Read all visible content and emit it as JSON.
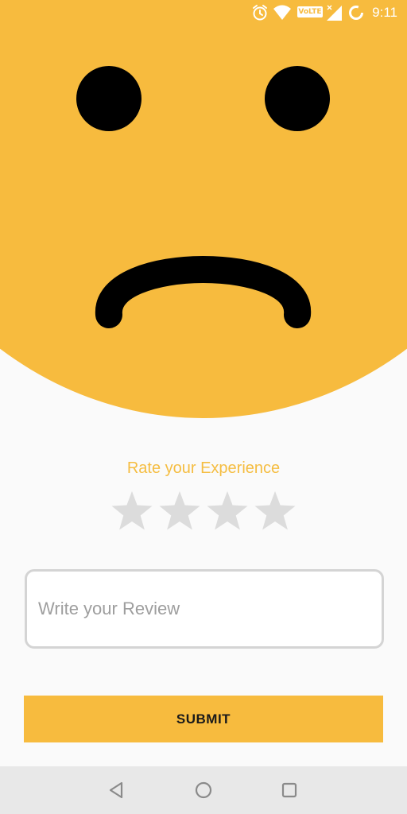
{
  "status_bar": {
    "time": "9:11",
    "network_badge": "VoLTE",
    "icons": [
      "alarm-icon",
      "wifi-icon",
      "volte-icon",
      "signal-icon",
      "battery-icon"
    ]
  },
  "face": {
    "mood": "sad",
    "color": "#f7bb3e",
    "feature_color": "#000000"
  },
  "rating": {
    "label": "Rate your Experience",
    "label_color": "#f5bd41",
    "star_count": 4,
    "selected": 0,
    "star_color": "#dcdcdc"
  },
  "review": {
    "placeholder": "Write your Review",
    "value": ""
  },
  "submit": {
    "label": "SUBMIT",
    "color": "#f7bb3e"
  },
  "nav_bar": {
    "buttons": [
      "back-icon",
      "home-icon",
      "recents-icon"
    ]
  }
}
